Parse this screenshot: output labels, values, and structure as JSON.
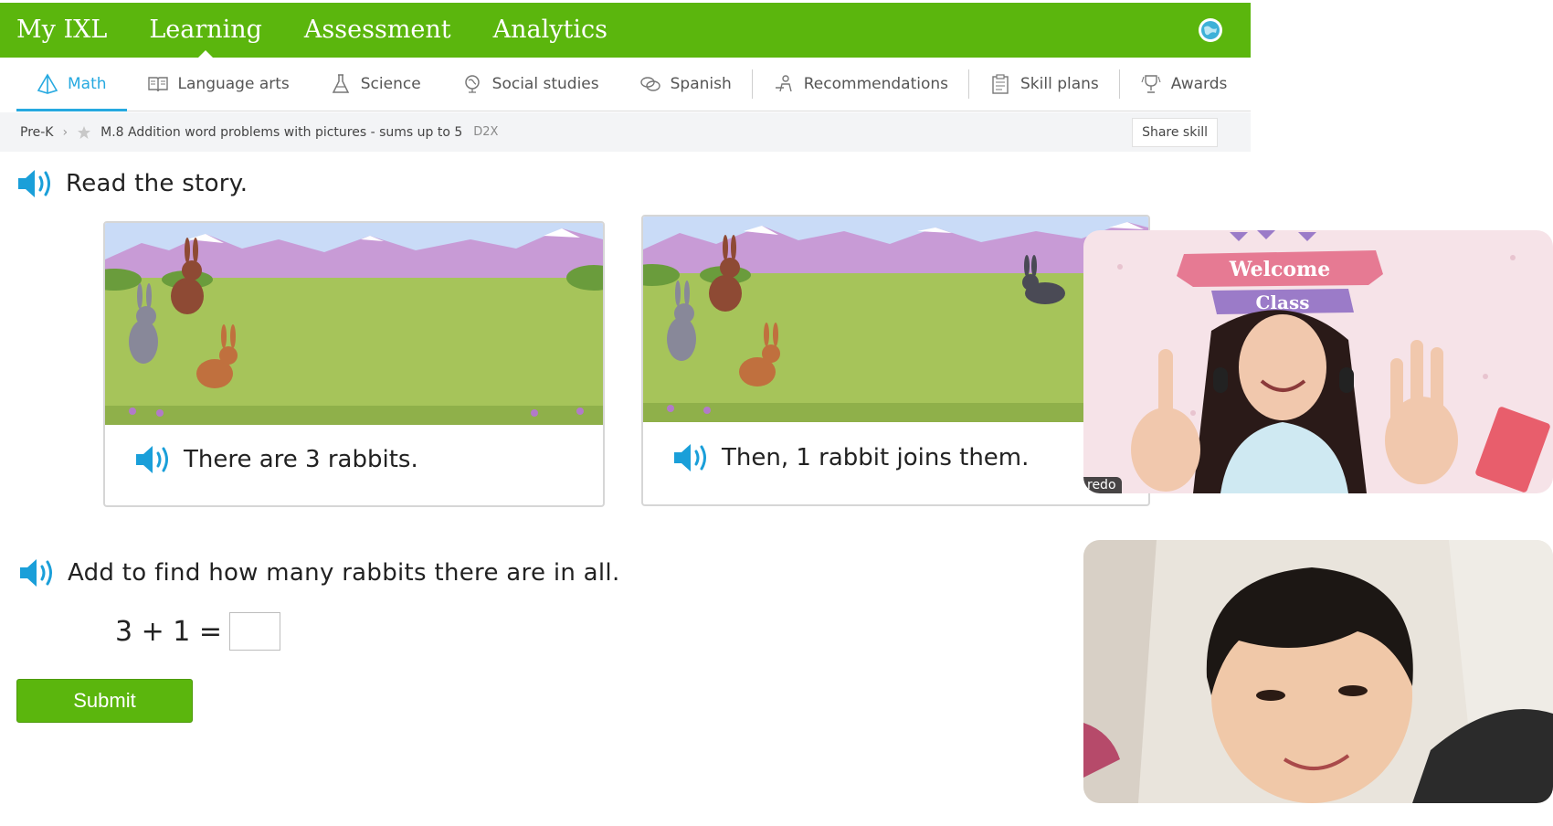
{
  "topnav": {
    "items": [
      {
        "label": "My IXL"
      },
      {
        "label": "Learning"
      },
      {
        "label": "Assessment"
      },
      {
        "label": "Analytics"
      }
    ],
    "active": "Learning",
    "brand_color": "#5bb60d"
  },
  "subnav": {
    "tabs": [
      {
        "label": "Math",
        "icon": "pyramid-icon"
      },
      {
        "label": "Language arts",
        "icon": "book-icon"
      },
      {
        "label": "Science",
        "icon": "flask-icon"
      },
      {
        "label": "Social studies",
        "icon": "globe-icon"
      },
      {
        "label": "Spanish",
        "icon": "speech-bubbles-icon"
      },
      {
        "label": "Recommendations",
        "icon": "person-icon"
      },
      {
        "label": "Skill plans",
        "icon": "clipboard-icon"
      },
      {
        "label": "Awards",
        "icon": "trophy-icon"
      }
    ],
    "active": "Math",
    "accent_color": "#26a9e0"
  },
  "breadcrumb": {
    "level": "Pre-K",
    "skill": "M.8 Addition word problems with pictures - sums up to 5",
    "code": "D2X",
    "share_label": "Share skill"
  },
  "question": {
    "story_prompt": "Read the story.",
    "cards": [
      {
        "caption": "There are 3 rabbits."
      },
      {
        "caption": "Then, 1 rabbit joins them."
      }
    ],
    "add_prompt": "Add to find how many rabbits there are in all.",
    "equation": "3 + 1 =",
    "answer_value": "",
    "submit_label": "Submit"
  },
  "video": {
    "teacher_banner_top": "Welcome",
    "teacher_banner_bottom": "Class",
    "teacher_name_fragment": "redo"
  }
}
